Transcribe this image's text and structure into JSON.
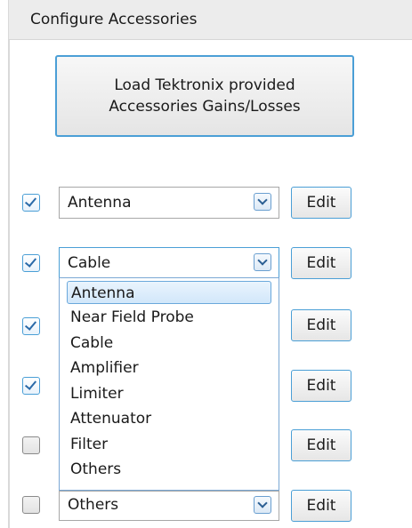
{
  "header": {
    "title": "Configure Accessories"
  },
  "load_button": {
    "line1": "Load Tektronix provided",
    "line2": "Accessories Gains/Losses"
  },
  "rows": [
    {
      "checked": true,
      "value": "Antenna",
      "edit_label": "Edit"
    },
    {
      "checked": true,
      "value": "Cable",
      "edit_label": "Edit"
    },
    {
      "checked": true,
      "value": "",
      "edit_label": "Edit"
    },
    {
      "checked": true,
      "value": "",
      "edit_label": "Edit"
    },
    {
      "checked": false,
      "value": "",
      "edit_label": "Edit"
    },
    {
      "checked": false,
      "value": "Others",
      "edit_label": "Edit"
    }
  ],
  "dropdown": {
    "highlighted": "Antenna",
    "options": [
      "Antenna",
      "Near Field Probe",
      "Cable",
      "Amplifier",
      "Limiter",
      "Attenuator",
      "Filter",
      "Others"
    ]
  }
}
